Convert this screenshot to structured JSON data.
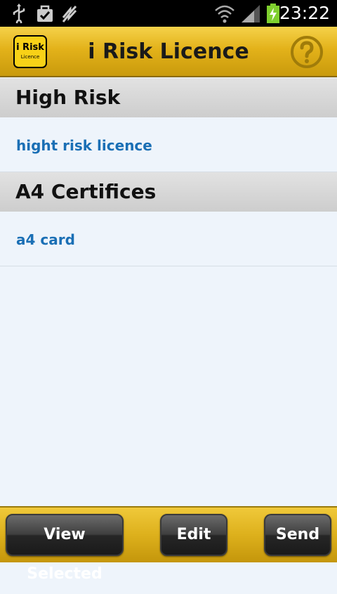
{
  "status_bar": {
    "time": "23:22",
    "icons": [
      "usb-icon",
      "download-done-icon",
      "sync-icon",
      "wifi-icon",
      "signal-icon",
      "battery-charging-icon"
    ]
  },
  "header": {
    "logo_main": "i Risk",
    "logo_sub": "Licence",
    "title": "i Risk Licence",
    "help_icon": "question-mark-icon"
  },
  "sections": [
    {
      "title": "High Risk",
      "items": [
        {
          "label": "hight risk licence"
        }
      ]
    },
    {
      "title": "A4 Certifices",
      "items": [
        {
          "label": "a4 card"
        }
      ]
    }
  ],
  "bottom_bar": {
    "view_selected_label": "View Selected",
    "edit_label": "Edit",
    "send_label": "Send"
  },
  "colors": {
    "header_gold": "#e3b21a",
    "link_blue": "#1a6fb5",
    "list_background": "#eef4fb",
    "section_gray": "#d5d5d5"
  }
}
